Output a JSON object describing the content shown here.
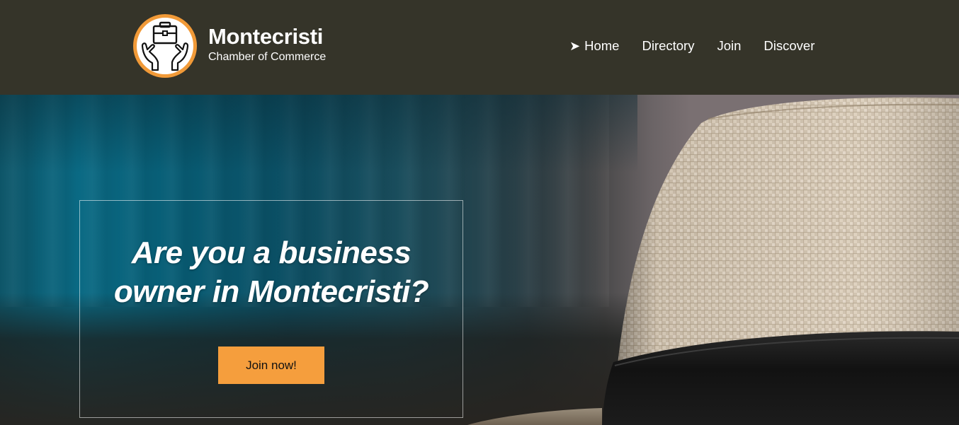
{
  "brand": {
    "logo_icon": "briefcase-hands-icon",
    "title": "Montecristi",
    "subtitle": "Chamber of Commerce",
    "logo_ring_color": "#f19a38"
  },
  "nav": {
    "active_marker_icon": "arrow-right-icon",
    "items": [
      {
        "label": "Home",
        "active": true
      },
      {
        "label": "Directory",
        "active": false
      },
      {
        "label": "Join",
        "active": false
      },
      {
        "label": "Discover",
        "active": false
      }
    ]
  },
  "hero": {
    "headline_line1": "Are you a business",
    "headline_line2": "owner in Montecristi?",
    "cta_label": "Join now!",
    "cta_color": "#f59e3d",
    "background_image": "straw-hat-photo"
  },
  "colors": {
    "header_bg": "#353429",
    "text": "#ffffff"
  }
}
